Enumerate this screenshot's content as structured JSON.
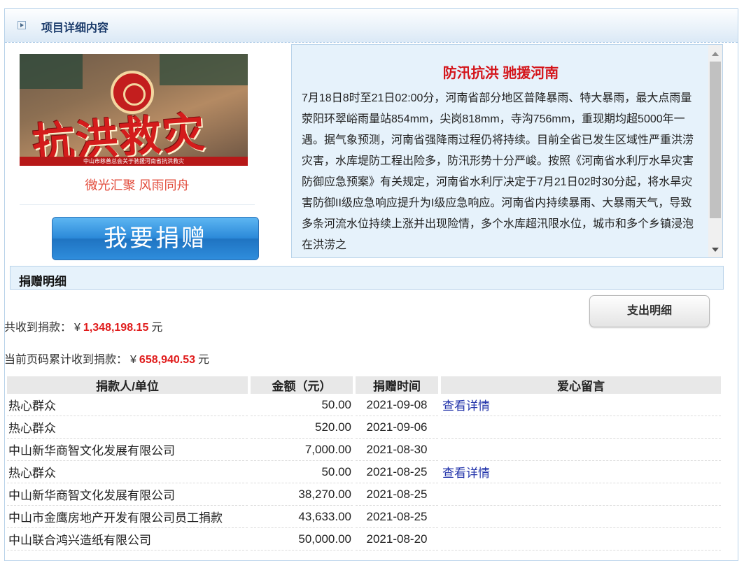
{
  "header": {
    "title": "项目详细内容"
  },
  "banner": {
    "image_text": "抗洪救灾",
    "strip_text": "中山市慈善总会关于驰援河南省抗洪救灾"
  },
  "slogan": "微光汇聚 风雨同舟",
  "donate_button": "我要捐赠",
  "news": {
    "title": "防汛抗洪 驰援河南",
    "body": "7月18日8时至21日02:00分，河南省部分地区普降暴雨、特大暴雨，最大点雨量荥阳环翠峪雨量站854mm，尖岗818mm，寺沟756mm，重现期均超5000年一遇。据气象预测，河南省强降雨过程仍将持续。目前全省已发生区域性严重洪涝灾害，水库堤防工程出险多，防汛形势十分严峻。按照《河南省水利厅水旱灾害防御应急预案》有关规定，河南省水利厅决定于7月21日02时30分起，将水旱灾害防御II级应急响应提升为I级应急响应。河南省内持续暴雨、大暴雨天气，导致多条河流水位持续上涨并出现险情，多个水库超汛限水位，城市和多个乡镇浸泡在洪涝之"
  },
  "donation_detail": {
    "title": "捐赠明细",
    "expense_button": "支出明细",
    "total_label": "共收到捐款：",
    "currency": "¥",
    "total_amount": "1,348,198.15",
    "unit": "元",
    "page_total_label": "当前页码累计收到捐款：",
    "page_total_amount": "658,940.53"
  },
  "table": {
    "headers": [
      "捐款人/单位",
      "金额（元）",
      "捐赠时间",
      "爱心留言"
    ],
    "rows": [
      {
        "donor": "热心群众",
        "amount": "50.00",
        "date": "2021-09-08",
        "message": "查看详情"
      },
      {
        "donor": "热心群众",
        "amount": "520.00",
        "date": "2021-09-06",
        "message": ""
      },
      {
        "donor": "中山新华商智文化发展有限公司",
        "amount": "7,000.00",
        "date": "2021-08-30",
        "message": ""
      },
      {
        "donor": "热心群众",
        "amount": "50.00",
        "date": "2021-08-25",
        "message": "查看详情"
      },
      {
        "donor": "中山新华商智文化发展有限公司",
        "amount": "38,270.00",
        "date": "2021-08-25",
        "message": ""
      },
      {
        "donor": "中山市金鹰房地产开发有限公司员工捐款",
        "amount": "43,633.00",
        "date": "2021-08-25",
        "message": ""
      },
      {
        "donor": "中山联合鸿兴造纸有限公司",
        "amount": "50,000.00",
        "date": "2021-08-20",
        "message": ""
      }
    ]
  }
}
